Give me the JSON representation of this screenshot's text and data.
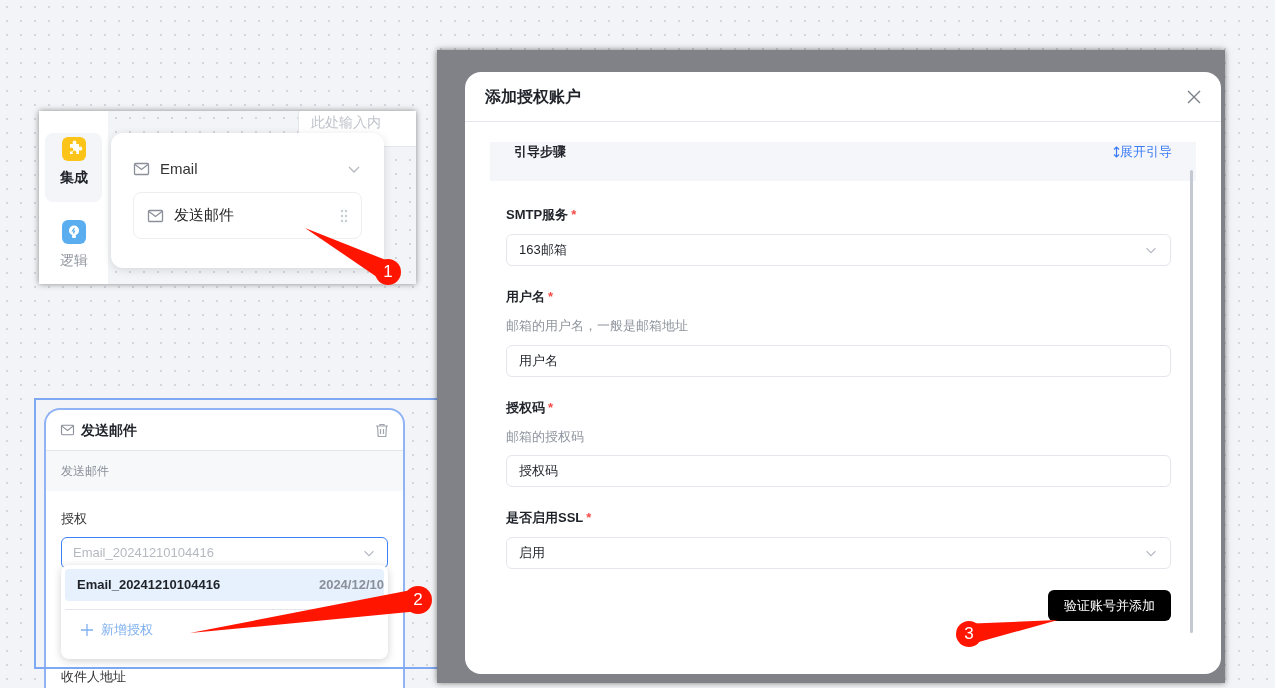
{
  "palette": {
    "search_placeholder": "此处输入内",
    "sidebar": [
      {
        "label": "集成",
        "kind": "puzzle",
        "selected": true
      },
      {
        "label": "逻辑",
        "kind": "bulb",
        "selected": false
      }
    ],
    "group": {
      "title": "Email",
      "expanded": true
    },
    "items": [
      "发送邮件"
    ]
  },
  "node": {
    "title": "发送邮件",
    "description": "发送邮件",
    "field_label": "授权",
    "select_placeholder": "Email_20241210104416",
    "dropdown": {
      "options": [
        {
          "name": "Email_20241210104416",
          "date": "2024/12/10",
          "selected": true
        }
      ],
      "add_label": "新增授权"
    },
    "next_label": "收件人地址"
  },
  "dialog": {
    "title": "添加授权账户",
    "guide": {
      "title": "引导步骤",
      "toggle": "展开引导"
    },
    "fields": [
      {
        "kind": "select",
        "label": "SMTP服务",
        "required_mark": "*",
        "value": "163邮箱"
      },
      {
        "kind": "input",
        "label": "用户名",
        "required_mark": "*",
        "hint": "邮箱的用户名，一般是邮箱地址",
        "value": "用户名"
      },
      {
        "kind": "input",
        "label": "授权码",
        "required_mark": "*",
        "hint": "邮箱的授权码",
        "value": "授权码"
      },
      {
        "kind": "select",
        "label": "是否启用SSL",
        "required_mark": "*",
        "value": "启用"
      }
    ],
    "submit": "验证账号并添加"
  },
  "annotations": [
    {
      "number": "1"
    },
    {
      "number": "2"
    },
    {
      "number": "3"
    }
  ]
}
